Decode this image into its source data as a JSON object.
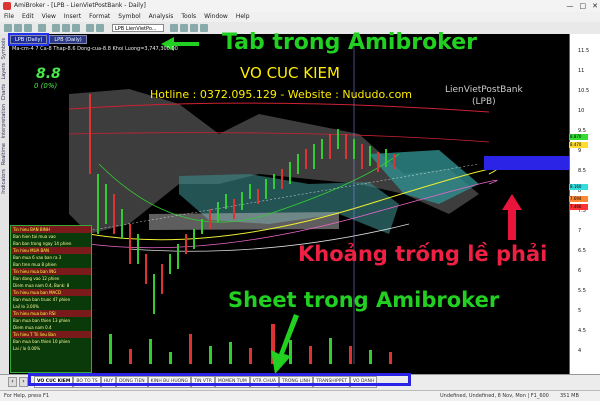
{
  "window": {
    "title": "AmiBroker - [LPB - LienVietPostBank - Daily]",
    "controls": [
      "—",
      "□",
      "✕"
    ]
  },
  "menu": [
    "File",
    "Edit",
    "View",
    "Insert",
    "Format",
    "Symbol",
    "Analysis",
    "Tools",
    "Window",
    "Help"
  ],
  "toolbar": {
    "symbol_value": "LPB LienVietPo..."
  },
  "left_strip": [
    "Symbols",
    "Layers",
    "Charts",
    "Interpretation",
    "Realtime",
    "Indicators"
  ],
  "chart_tabs": [
    "LPB (Daily)",
    "LPB (Daily)"
  ],
  "info_line": "Ma-cm-4 7 Ca-8 Thap-8.6 Dong-cua-8.8 Khoi Luong=3,747,300.00",
  "price": {
    "value": "8.8",
    "change": "0 (0%)"
  },
  "brand": {
    "name": "VO CUC KIEM",
    "hotline": "Hotline : 0372.095.129 - Website : Nududo.com"
  },
  "stock": {
    "name": "LienVietPostBank",
    "code": "(LPB)"
  },
  "annotations": {
    "tab": "Tab trong Amibroker",
    "space": "Khoảng trống lề phải",
    "sheet": "Sheet trong Amibroker"
  },
  "signal_boxes": [
    {
      "header": "Tin hieu BAN BINH",
      "lines": [
        "Ban hien tai mua vao",
        "Ban ban trong ngay 14 phien"
      ]
    },
    {
      "header": "Tin hieu MUA BAN",
      "lines": [
        "Ban mua 6 vao ban ra 3",
        "Ban tren mua 8 phien"
      ]
    },
    {
      "header": "Tin hieu mua ban ING",
      "lines": [
        "Ban dang vao 12 phien",
        "Diem mua nam 0.4, Bank: 8"
      ]
    },
    {
      "header": "Tin hieu mua ban MACD",
      "lines": [
        "Ban mua ban truoc 47 phien",
        "Lai/ lo 3.00%"
      ]
    },
    {
      "header": "Tin hieu mua ban RSI",
      "lines": [
        "Ban mua ban thien 13 phien",
        "Diem mua nam 0.4"
      ]
    },
    {
      "header": "Tin hieu T Tri lieu Ban",
      "lines": [
        "Ban mua ban thien 10 phien",
        "Lai / lo 0.00%"
      ]
    }
  ],
  "price_axis": [
    "11.5",
    "11",
    "10.5",
    "10",
    "9.5",
    "9",
    "8.5",
    "8",
    "7.5",
    "7",
    "6.5",
    "6",
    "5.5",
    "5",
    "4.5",
    "4"
  ],
  "price_tags": [
    {
      "label": "8.870",
      "color": "#33dd33"
    },
    {
      "label": "8.470",
      "color": "#ffdd33"
    },
    {
      "label": "8.160",
      "color": "#33dddd"
    },
    {
      "label": "7.694",
      "color": "#ff8833"
    },
    {
      "label": "7.466",
      "color": "#ff3333"
    }
  ],
  "sheets": [
    "VO CUC KIEM",
    "BO TO TS",
    "HUY",
    "DONG TIEN",
    "KINH BU HUONG",
    "TIN VTR",
    "MOMEN TUM",
    "VTR CHUA",
    "TRONG LINH",
    "TRANSHIPPET",
    "VO DANH"
  ],
  "status": {
    "left": "For Help, press F1",
    "mid": "Undefined, Undefined, 8 Nov, Mon | F1_600",
    "right": "351 MB"
  },
  "colors": {
    "accent_blue": "#2b24e6",
    "green_annotation": "#21d021",
    "red_annotation": "#ee2044",
    "brand_yellow": "#ffee00"
  }
}
